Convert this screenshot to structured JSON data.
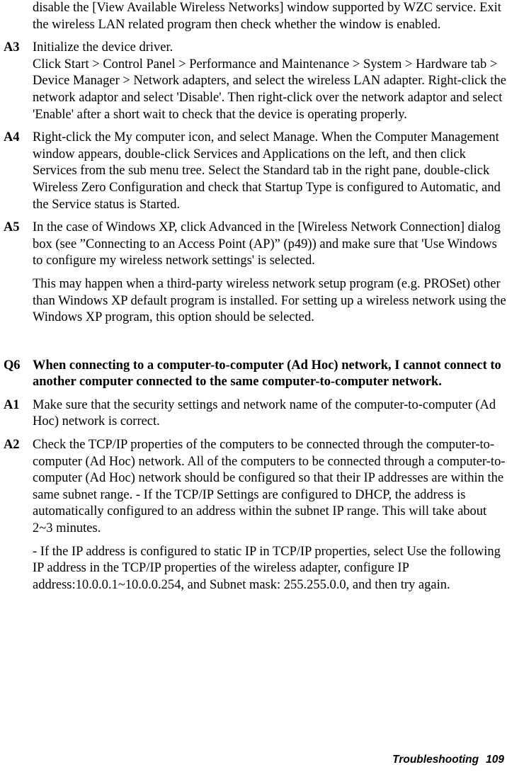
{
  "document": {
    "type": "wireless-lan-user-manual-troubleshooting-page",
    "continued_paragraph": "disable the [View Available Wireless Networks] window supported by WZC service. Exit the wireless LAN related program then check whether the window is enabled."
  },
  "entries": [
    {
      "label": "A3",
      "paragraphs": [
        "Initialize the device driver.",
        "Click Start > Control Panel > Performance and Maintenance > System > Hardware tab > Device Manager > Network adapters, and select the wireless LAN adapter. Right-click the network adaptor and select 'Disable'. Then right-click over the network adaptor and select 'Enable' after a short wait to check that the device is operating properly."
      ],
      "bold": false,
      "paragraph_spacing": false
    },
    {
      "label": "A4",
      "paragraphs": [
        "Right-click the My computer icon, and select Manage. When the Computer Management window appears, double-click Services and Applications on the left, and then click Services from the sub menu tree. Select the Standard tab in the right pane, double-click Wireless Zero Configuration and check that Startup Type is configured to Automatic, and the Service status is Started."
      ],
      "bold": false,
      "paragraph_spacing": false
    },
    {
      "label": "A5",
      "paragraphs": [
        "In the case of Windows XP, click Advanced in the [Wireless Network Connection] dialog box (see ”Connecting to an Access Point (AP)” (p49)) and make sure that 'Use Windows to configure my wireless network settings' is selected.",
        "This may happen when a third-party wireless network setup program (e.g. PROSet) other than Windows XP default program is installed. For setting up a wireless network using the Windows XP program, this option should be selected."
      ],
      "bold": false,
      "paragraph_spacing": true
    },
    {
      "label": "Q6",
      "paragraphs": [
        "When connecting to a computer-to-computer (Ad Hoc) network, I cannot connect to another computer connected to the same computer-to-computer network."
      ],
      "bold": true,
      "paragraph_spacing": false,
      "section_break_before": true
    },
    {
      "label": "A1",
      "paragraphs": [
        "Make sure that the security settings and network name of the computer-to-computer (Ad Hoc) network is correct."
      ],
      "bold": false,
      "paragraph_spacing": false
    },
    {
      "label": "A2",
      "paragraphs": [
        "Check the TCP/IP properties of the computers to be connected through the computer-to-computer (Ad Hoc) network. All of the computers to be connected through a computer-to-computer (Ad Hoc) network should be configured so that their IP addresses are within the same subnet range.\n- If the TCP/IP Settings are configured to DHCP, the address is automatically configured to an address within the subnet IP range. This will take about 2~3 minutes.",
        "- If the IP address is configured to static IP in TCP/IP properties, select Use the following IP address in the TCP/IP properties of the wireless adapter, configure IP address:10.0.0.1~10.0.0.254, and Subnet mask: 255.255.0.0, and then try again."
      ],
      "bold": false,
      "paragraph_spacing": true
    }
  ],
  "footer": {
    "section_title": "Troubleshooting",
    "page_number": "109"
  }
}
